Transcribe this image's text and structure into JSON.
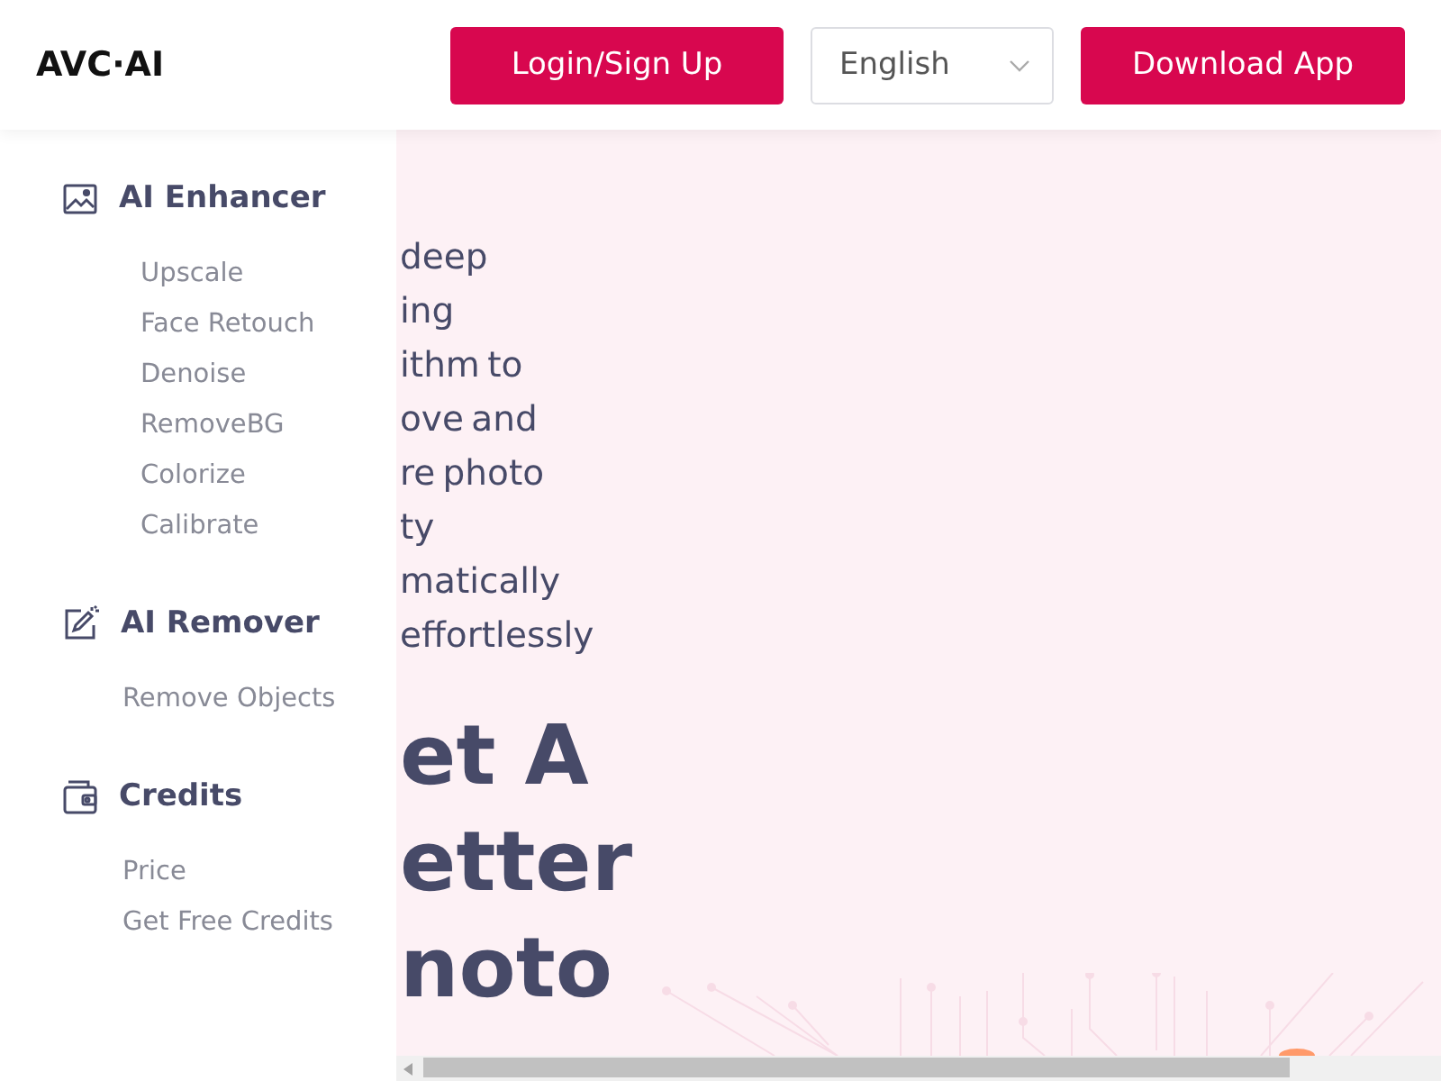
{
  "header": {
    "logo": "AVC·AI",
    "login_button": "Login/Sign Up",
    "language_select": {
      "value": "English"
    },
    "download_button": "Download App"
  },
  "sidebar": {
    "sections": [
      {
        "kind": "image",
        "title": "AI Enhancer",
        "items": [
          "Upscale",
          "Face Retouch",
          "Denoise",
          "RemoveBG",
          "Colorize",
          "Calibrate"
        ]
      },
      {
        "kind": "wand",
        "title": "AI Remover",
        "items": [
          "Remove Objects"
        ]
      },
      {
        "kind": "wallet",
        "title": "Credits",
        "items": [
          "Price",
          "Get Free Credits"
        ]
      }
    ]
  },
  "main": {
    "description_lines": [
      "deep",
      "ing",
      "ithm to",
      "ove and",
      "re photo",
      "ty",
      "matically",
      "effortlessly"
    ],
    "headline_lines": [
      "et A",
      "etter",
      "noto"
    ]
  }
}
